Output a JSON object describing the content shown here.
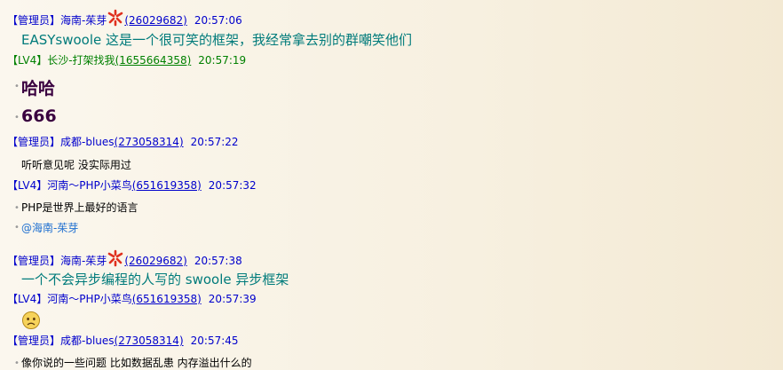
{
  "messages": [
    {
      "role": "【管理员】",
      "name": "海南-茱芽",
      "qq": "(26029682)",
      "time": "20:57:06",
      "text": "EASYswoole 这是一个很可笑的框架，我经常拿去别的群嘲笑他们"
    },
    {
      "role": "【LV4】",
      "name": "长沙-打架找我",
      "qq": "(1655664358)",
      "time": "20:57:19",
      "lines": [
        "哈哈",
        "666"
      ]
    },
    {
      "role": "【管理员】",
      "name": "成都-blues",
      "qq": "(273058314)",
      "time": "20:57:22",
      "text": "听听意见呢 没实际用过"
    },
    {
      "role": "【LV4】",
      "name": "河南～PHP小菜鸟",
      "qq": "(651619358)",
      "time": "20:57:32",
      "lines": [
        "PHP是世界上最好的语言",
        "@海南-茱芽"
      ]
    },
    {
      "role": "【管理员】",
      "name": "海南-茱芽",
      "qq": "(26029682)",
      "time": "20:57:38",
      "text": "一个不会异步编程的人写的 swoole 异步框架"
    },
    {
      "role": "【LV4】",
      "name": "河南～PHP小菜鸟",
      "qq": "(651619358)",
      "time": "20:57:39",
      "emoji": "sad-face-emoji"
    },
    {
      "role": "【管理员】",
      "name": "成都-blues",
      "qq": "(273058314)",
      "time": "20:57:45",
      "text": "像你说的一些问题 比如数据乱患 内存溢出什么的"
    }
  ],
  "colors": {
    "admin": "#0000cc",
    "member": "#008000",
    "teal": "#007b7b",
    "big": "#3a0040",
    "mention": "#1e6fd0"
  }
}
